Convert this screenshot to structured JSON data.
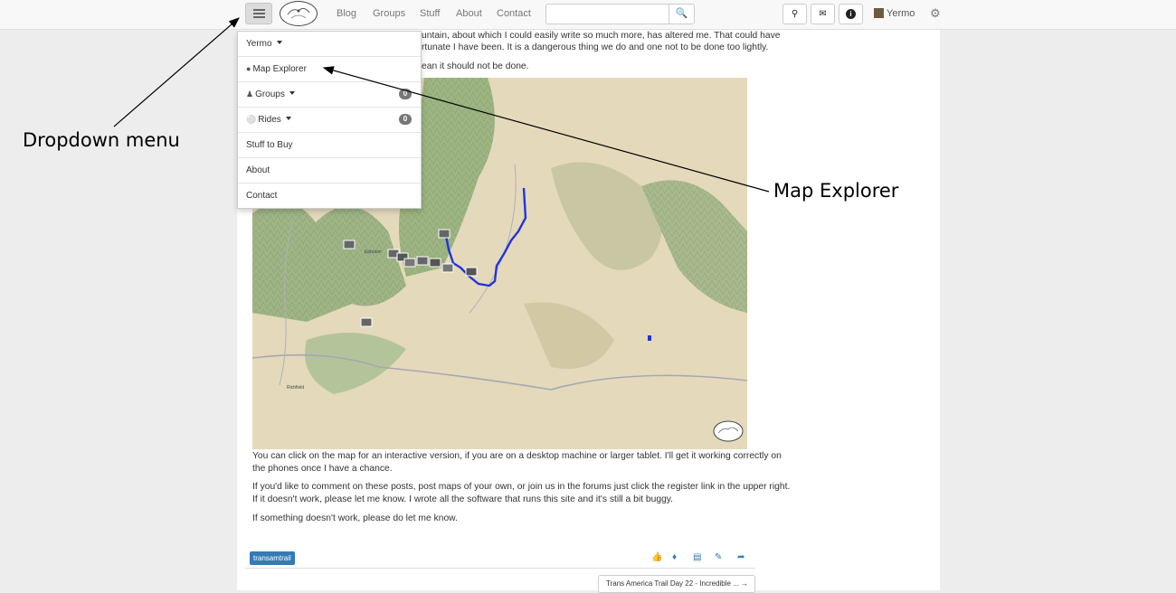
{
  "navbar": {
    "links": [
      "Blog",
      "Groups",
      "Stuff",
      "About",
      "Contact"
    ],
    "search_placeholder": "",
    "user_name": "Yermo",
    "icons": [
      "search-zoom-icon",
      "envelope-icon",
      "info-icon",
      "gear-icon"
    ]
  },
  "dropdown": {
    "items": [
      {
        "label": "Yermo",
        "icon": "",
        "badge": "",
        "caret": true
      },
      {
        "label": "Map Explorer",
        "icon": "globe-icon",
        "badge": "",
        "caret": false
      },
      {
        "label": "Groups",
        "icon": "users-icon",
        "badge": "0",
        "caret": true
      },
      {
        "label": "Rides",
        "icon": "motorcycle-icon",
        "badge": "0",
        "caret": true
      },
      {
        "label": "Stuff to Buy",
        "icon": "",
        "badge": "",
        "caret": false
      },
      {
        "label": "About",
        "icon": "",
        "badge": "",
        "caret": false
      },
      {
        "label": "Contact",
        "icon": "",
        "badge": "",
        "caret": false
      }
    ]
  },
  "article": {
    "line1": "untain, about which I could easily write so much more, has altered me. That could have",
    "line2": "rtunate I have been. It is a dangerous thing we do and one not to be done too lightly.",
    "line3": "ean it should not be done.",
    "para_map_1": "You can click on the map for an interactive version, if you are on a desktop machine or larger tablet. I'll get it working correctly on",
    "para_map_2": "the phones once I have a chance.",
    "para_comment_1": "If you'd like to comment on these posts, post maps of your own, or join us in the forums just click the register link in the upper right.",
    "para_comment_2": "If it doesn't work, please let me know. I wrote all the software that runs this site and it's still a bit buggy.",
    "para_last": "If something doesn't work, please do let me know."
  },
  "map": {
    "towns": [
      "Ephraim",
      "Richfield"
    ],
    "route_color": "#2233dd"
  },
  "footer": {
    "tag": "transamtrail",
    "next_post": "Trans America Trail Day 22 - Incredible ..."
  },
  "annotations": {
    "dropdown_label": "Dropdown menu",
    "map_explorer_label": "Map Explorer"
  }
}
